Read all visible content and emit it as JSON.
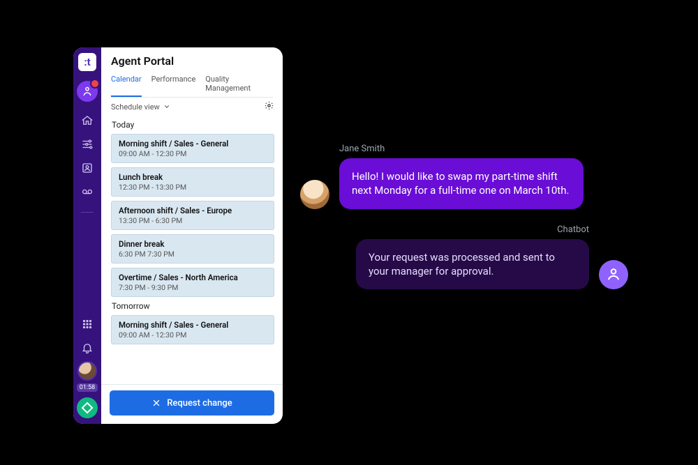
{
  "portal": {
    "title": "Agent Portal",
    "tabs": {
      "calendar": "Calendar",
      "performance": "Performance",
      "quality": "Quality Management"
    },
    "scheduleViewLabel": "Schedule view",
    "sections": [
      {
        "label": "Today",
        "slots": [
          {
            "title": "Morning shift / Sales - General",
            "time": "09:00 AM - 12:30 PM"
          },
          {
            "title": "Lunch break",
            "time": "12:30 PM - 13:30 PM"
          },
          {
            "title": "Afternoon shift / Sales - Europe",
            "time": "13:30 PM - 6:30 PM"
          },
          {
            "title": "Dinner break",
            "time": "6:30 PM 7:30 PM"
          },
          {
            "title": "Overtime / Sales - North America",
            "time": "7:30 PM - 9:30 PM"
          }
        ]
      },
      {
        "label": "Tomorrow",
        "slots": [
          {
            "title": "Morning shift / Sales - General",
            "time": "09:00 AM - 12:30 PM"
          }
        ]
      }
    ],
    "requestChangeLabel": "Request change",
    "rail": {
      "timer": "01:58"
    }
  },
  "chat": {
    "userName": "Jane Smith",
    "userMsg": "Hello! I would like to swap my part-time shift next Monday for a full-time one on March 10th.",
    "botName": "Chatbot",
    "botMsg": "Your request was processed and sent to your manager for approval."
  }
}
